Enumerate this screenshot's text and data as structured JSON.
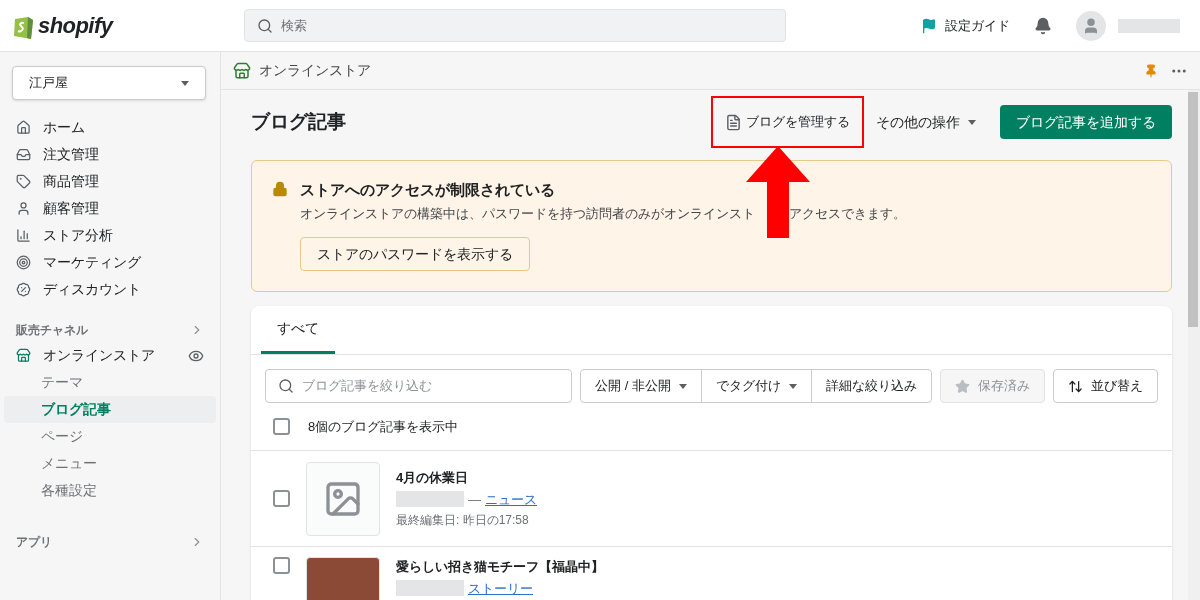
{
  "header": {
    "logo": "shopify",
    "search": {
      "placeholder": "検索"
    },
    "setup_guide": "設定ガイド"
  },
  "sidebar": {
    "store_select": "江戸屋",
    "items": [
      {
        "label": "ホーム"
      },
      {
        "label": "注文管理"
      },
      {
        "label": "商品管理"
      },
      {
        "label": "顧客管理"
      },
      {
        "label": "ストア分析"
      },
      {
        "label": "マーケティング"
      },
      {
        "label": "ディスカウント"
      }
    ],
    "sales_channels": {
      "title": "販売チャネル",
      "channel": "オンラインストア",
      "children": [
        {
          "label": "テーマ",
          "selected": false
        },
        {
          "label": "ブログ記事",
          "selected": true
        },
        {
          "label": "ページ",
          "selected": false
        },
        {
          "label": "メニュー",
          "selected": false
        },
        {
          "label": "各種設定",
          "selected": false
        }
      ]
    },
    "apps": "アプリ"
  },
  "breadcrumb": "オンラインストア",
  "page": {
    "title": "ブログ記事",
    "manage_blogs": "ブログを管理する",
    "more_actions": "その他の操作",
    "add_article": "ブログ記事を追加する"
  },
  "banner": {
    "title": "ストアへのアクセスが制限されている",
    "message_parts": [
      "オンラインストアの構築中は、パスワードを持つ訪問者のみがオンラインスト",
      "アクセスできます。"
    ],
    "button": "ストアのパスワードを表示する"
  },
  "tabs": [
    {
      "label": "すべて",
      "selected": true
    }
  ],
  "filter": {
    "placeholder": "ブログ記事を絞り込む",
    "filters": [
      {
        "label": "公開 / 非公開",
        "dropdown": true
      },
      {
        "label": "でタグ付け",
        "dropdown": true
      },
      {
        "label": "詳細な絞り込み",
        "dropdown": false
      }
    ],
    "saved": {
      "label": "保存済み",
      "disabled": true
    },
    "sort": "並び替え"
  },
  "count": {
    "label": "8個のブログ記事を表示中",
    "checked": false
  },
  "articles": [
    {
      "title": "4月の休業日",
      "dash": "—",
      "blog": "ニュース",
      "edited": "最終編集日: 昨日の17:58",
      "checked": false,
      "kind": "placeholder"
    },
    {
      "title": "愛らしい招き猫モチーフ【福晶中】",
      "blog": "ストーリー",
      "checked": false,
      "kind": "photo"
    }
  ]
}
